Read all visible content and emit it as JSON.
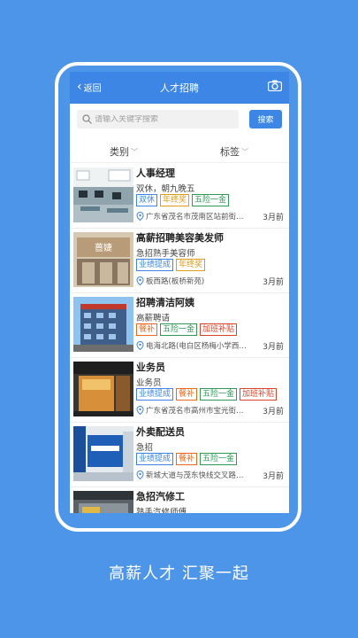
{
  "header": {
    "back_label": "返回",
    "title": "人才招聘"
  },
  "search": {
    "placeholder": "请输入关键字搜索",
    "button_label": "搜索"
  },
  "filters": [
    {
      "label": "类别"
    },
    {
      "label": "标签"
    }
  ],
  "jobs": [
    {
      "title": "人事经理",
      "subtitle": "双休，朝九晚五",
      "tags": [
        "双休",
        "年终奖",
        "五险一金"
      ],
      "location": "广东省茂名市茂南区站前街…",
      "time": "3月前"
    },
    {
      "title": "高薪招聘美容美发师",
      "subtitle": "急招熟手美容师",
      "tags": [
        "业绩提成",
        "年终奖"
      ],
      "location": "板西路(板桥新苑)",
      "time": "3月前"
    },
    {
      "title": "招聘清洁阿姨",
      "subtitle": "高薪聘请",
      "tags": [
        "餐补",
        "五险一金",
        "加班补贴"
      ],
      "location": "电海北路(电白区杨梅小学西…",
      "time": "3月前"
    },
    {
      "title": "业务员",
      "subtitle": "业务员",
      "tags": [
        "业绩提成",
        "餐补",
        "五险一金",
        "加班补贴"
      ],
      "location": "广东省茂名市高州市宝光街…",
      "time": "3月前"
    },
    {
      "title": "外卖配送员",
      "subtitle": "急招",
      "tags": [
        "业绩提成",
        "餐补",
        "五险一金"
      ],
      "location": "新城大道与茂东快线交叉路…",
      "time": "3月前"
    },
    {
      "title": "急招汽修工",
      "subtitle": "熟手汽修师傅",
      "tags": [],
      "location": "",
      "time": ""
    }
  ],
  "tag_colors": {
    "双休": "#3d86e5",
    "年终奖": "#e09a1c",
    "五险一金": "#2e9a55",
    "业绩提成": "#3d86e5",
    "餐补": "#e8691c",
    "加班补贴": "#d9432a"
  },
  "thumb_text": {
    "salon": "蔷婕"
  },
  "slogan": "高薪人才 汇聚一起"
}
